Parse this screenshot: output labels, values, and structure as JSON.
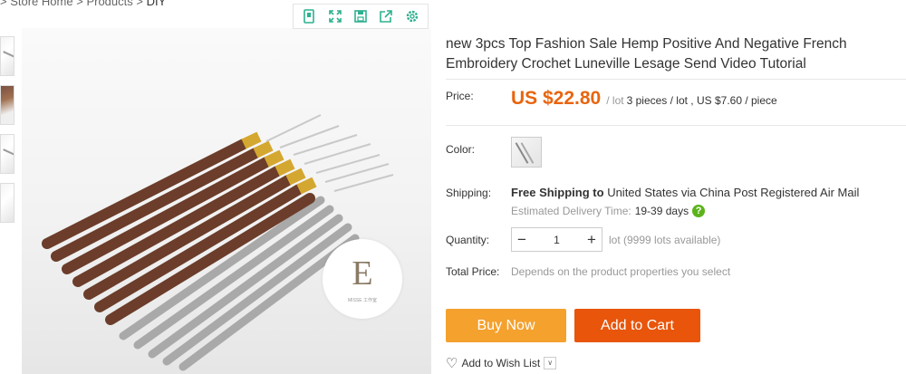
{
  "breadcrumb": {
    "items": [
      ">",
      "Store Home",
      ">",
      "Products",
      ">"
    ],
    "last": "DIY"
  },
  "gallery": {
    "toolbar_icons": [
      "phone-icon",
      "expand-icon",
      "save-icon",
      "share-icon",
      "settings-icon"
    ],
    "logo_letter": "E",
    "logo_text": "MISSE 工作室"
  },
  "product": {
    "title": "new 3pcs Top Fashion Sale Hemp Positive And Negative French Embroidery Crochet Luneville Lesage Send Video Tutorial",
    "price_label": "Price:",
    "price": "US $22.80",
    "price_unit": "/ lot",
    "price_detail": "3 pieces / lot , US $7.60 / piece",
    "color_label": "Color:",
    "shipping_label": "Shipping:",
    "shipping_bold": "Free Shipping to",
    "shipping_text": "United States via China Post Registered Air Mail",
    "est_label": "Estimated Delivery Time:",
    "est_days": "19-39 days",
    "quantity_label": "Quantity:",
    "quantity_value": "1",
    "minus": "−",
    "plus": "+",
    "lots_text": "lot (9999 lots available)",
    "total_label": "Total Price:",
    "total_note": "Depends on the product properties you select",
    "buy_now": "Buy Now",
    "add_to_cart": "Add to Cart",
    "wish_list": "Add to Wish List"
  },
  "colors": {
    "price": "#e8650f",
    "buy_now": "#f4a12e",
    "add_to_cart": "#e8550b",
    "toolbar_icon": "#2fb08f"
  }
}
